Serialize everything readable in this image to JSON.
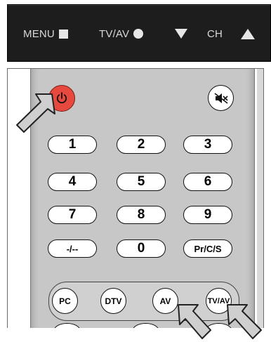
{
  "panel": {
    "menu_label": "MENU",
    "tvav_label": "TV/AV",
    "ch_label": "CH",
    "menu_icon": "square-icon",
    "tvav_icon": "circle-icon",
    "down_icon": "triangle-down-icon",
    "up_icon": "triangle-up-icon"
  },
  "remote": {
    "power_icon": "power-icon",
    "mute_icon": "mute-icon",
    "keys": [
      "1",
      "2",
      "3",
      "4",
      "5",
      "6",
      "7",
      "8",
      "9",
      "-/--",
      "0",
      "Pr/C/S"
    ],
    "sources": [
      "PC",
      "DTV",
      "AV",
      "TV/AV"
    ]
  },
  "colors": {
    "panel_bg": "#1d1d1d",
    "remote_body": "#c7c7c7",
    "power_red": "#e8493f",
    "arrow_fill": "#cfcfcf"
  }
}
